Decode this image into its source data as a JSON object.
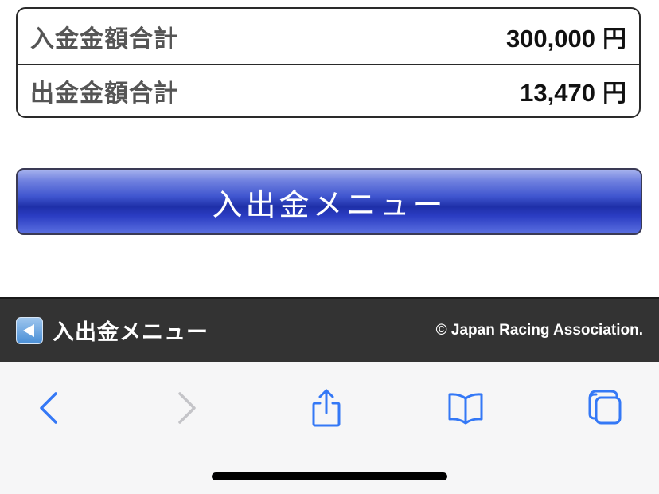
{
  "summary": {
    "rows": [
      {
        "label": "入金金額合計",
        "value": "300,000",
        "unit": "円"
      },
      {
        "label": "出金金額合計",
        "value": "13,470",
        "unit": "円"
      }
    ]
  },
  "menu_button": {
    "label": "入出金メニュー"
  },
  "footer": {
    "back_label": "入出金メニュー",
    "copyright": "© Japan Racing Association."
  },
  "toolbar": {
    "icons": [
      "back-icon",
      "forward-icon",
      "share-icon",
      "bookmarks-icon",
      "tabs-icon"
    ],
    "accent": "#3478f6",
    "disabled": "#c4c4c8"
  }
}
